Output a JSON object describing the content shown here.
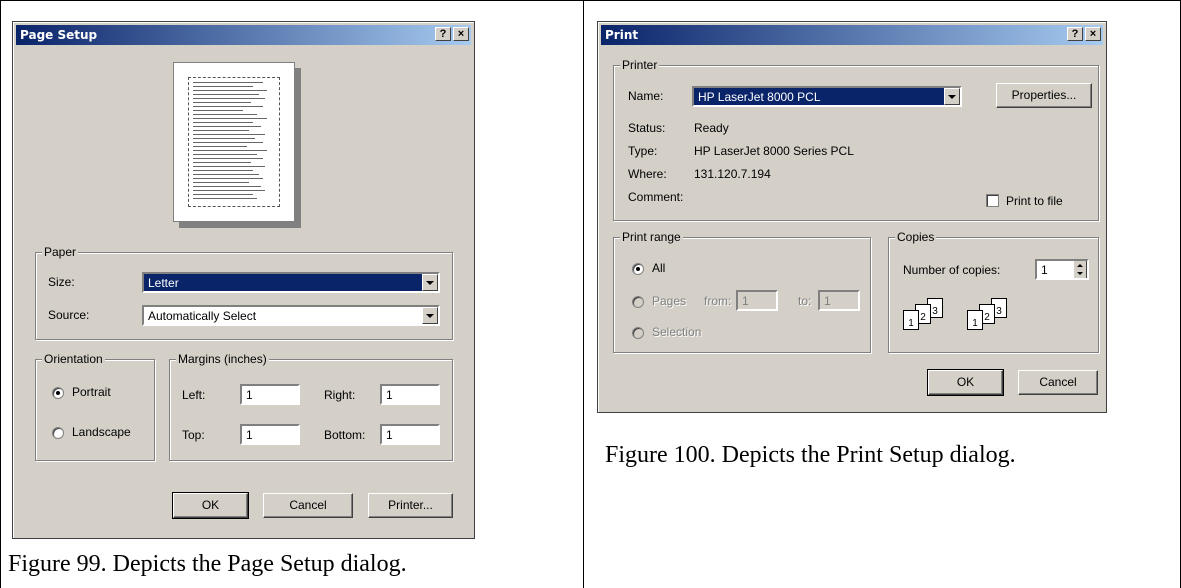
{
  "page_setup": {
    "title": "Page Setup",
    "help_label": "?",
    "close_label": "×",
    "paper_group": "Paper",
    "size_label": "Size:",
    "size_value": "Letter",
    "source_label": "Source:",
    "source_value": "Automatically Select",
    "orientation_group": "Orientation",
    "portrait_label": "Portrait",
    "landscape_label": "Landscape",
    "portrait_selected": true,
    "margins_group": "Margins (inches)",
    "left_label": "Left:",
    "left_value": "1",
    "right_label": "Right:",
    "right_value": "1",
    "top_label": "Top:",
    "top_value": "1",
    "bottom_label": "Bottom:",
    "bottom_value": "1",
    "ok_label": "OK",
    "cancel_label": "Cancel",
    "printer_label": "Printer..."
  },
  "print": {
    "title": "Print",
    "help_label": "?",
    "close_label": "×",
    "printer_group": "Printer",
    "name_label": "Name:",
    "name_value": "HP LaserJet 8000  PCL",
    "properties_label": "Properties...",
    "status_label": "Status:",
    "status_value": "Ready",
    "type_label": "Type:",
    "type_value": "HP LaserJet 8000 Series PCL",
    "where_label": "Where:",
    "where_value": "131.120.7.194",
    "comment_label": "Comment:",
    "print_to_file_label": "Print to file",
    "range_group": "Print range",
    "all_label": "All",
    "pages_label": "Pages",
    "from_label": "from:",
    "from_value": "1",
    "to_label": "to:",
    "to_value": "1",
    "selection_label": "Selection",
    "copies_group": "Copies",
    "copies_label": "Number of copies:",
    "copies_value": "1",
    "collate_numbers": [
      "1",
      "2",
      "3"
    ],
    "ok_label": "OK",
    "cancel_label": "Cancel"
  },
  "captions": {
    "fig99": "Figure 99.  Depicts the Page Setup dialog.",
    "fig100": "Figure 100.  Depicts the Print Setup dialog."
  },
  "colors": {
    "dialog_bg": "#d4d0c8",
    "title_start": "#0a246a",
    "title_end": "#a6caf0",
    "selection": "#0a246a"
  }
}
